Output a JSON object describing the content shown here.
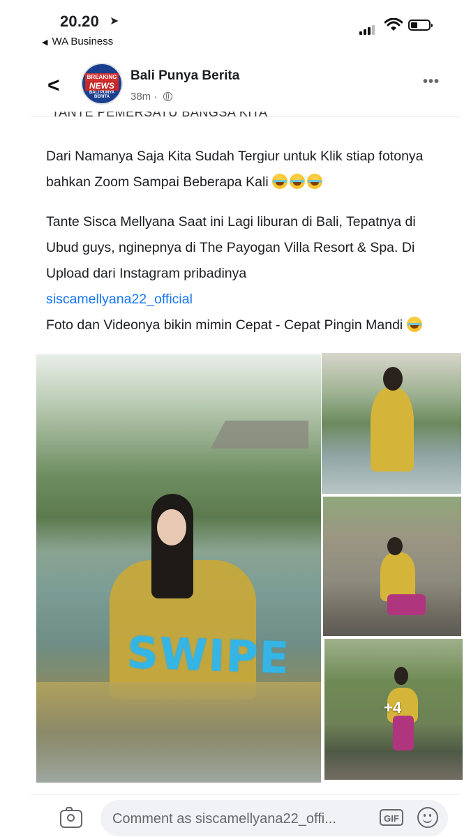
{
  "status_bar": {
    "time": "20.20",
    "back_app": "WA Business"
  },
  "header": {
    "page_name": "Bali Punya Berita",
    "time_ago": "38m",
    "avatar_text": {
      "line1": "BREAKING",
      "line2": "NEWS",
      "line3": "BALI PUNYA BERITA"
    }
  },
  "post": {
    "cut_line": "TANTE PEMERSATU BANGSA KITA",
    "p1": "Dari Namanya Saja Kita Sudah Tergiur untuk Klik stiap fotonya bahkan Zoom Sampai Beberapa Kali",
    "p2": "Tante Sisca Mellyana Saat ini Lagi liburan di Bali, Tepatnya di Ubud guys, nginepnya di The Payogan Villa Resort & Spa. Di Upload dari Instagram pribadinya",
    "link": "siscamellyana22_official",
    "p3": "Foto dan Videonya bikin mimin Cepat - Cepat Pingin Mandi"
  },
  "gallery": {
    "overlay_text": "SWIPE",
    "more_count": "+4"
  },
  "comment_bar": {
    "placeholder": "Comment as siscamellyana22_offi...",
    "gif_label": "GIF"
  },
  "icons": {
    "location": "location-arrow-icon",
    "back": "chevron-left-icon",
    "globe": "globe-icon",
    "more": "more-horizontal-icon",
    "camera": "camera-icon",
    "emoji": "smile-icon"
  }
}
